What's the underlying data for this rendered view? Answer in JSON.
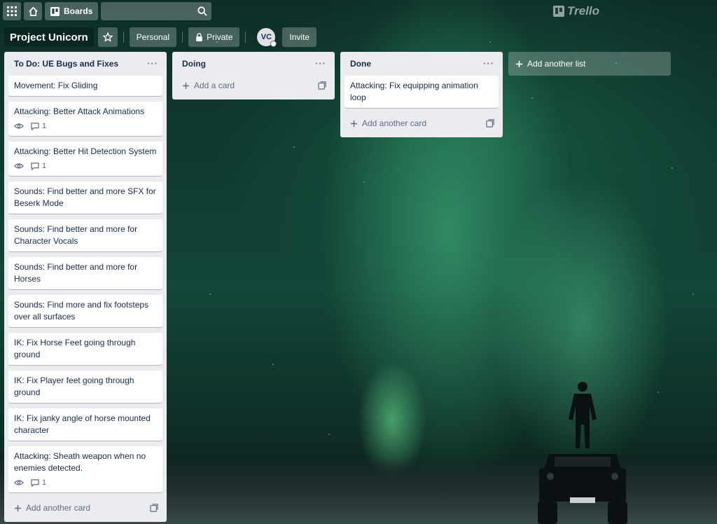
{
  "header": {
    "boards_label": "Boards",
    "search_placeholder": "",
    "logo_text": "Trello"
  },
  "board": {
    "title": "Project Unicorn",
    "personal_label": "Personal",
    "private_label": "Private",
    "avatar_initials": "VC",
    "invite_label": "Invite"
  },
  "lists": [
    {
      "title": "To Do: UE Bugs and Fixes",
      "cards": [
        {
          "title": "Movement: Fix Gliding"
        },
        {
          "title": "Attacking: Better Attack Animations",
          "comments": "1"
        },
        {
          "title": "Attacking: Better Hit Detection System",
          "comments": "1"
        },
        {
          "title": "Sounds: Find better and more SFX for Beserk Mode"
        },
        {
          "title": "Sounds: Find better and more for Character Vocals"
        },
        {
          "title": "Sounds: Find better and more for Horses"
        },
        {
          "title": "Sounds: Find more and fix footsteps over all surfaces"
        },
        {
          "title": "IK: Fix Horse Feet going through ground"
        },
        {
          "title": "IK: Fix Player feet going through ground"
        },
        {
          "title": "IK: Fix janky angle of horse mounted character"
        },
        {
          "title": "Attacking: Sheath weapon when no enemies detected.",
          "comments": "1"
        }
      ],
      "add_label": "Add another card"
    },
    {
      "title": "Doing",
      "cards": [],
      "add_label": "Add a card"
    },
    {
      "title": "Done",
      "cards": [
        {
          "title": "Attacking: Fix equipping animation loop"
        }
      ],
      "add_label": "Add another card"
    }
  ],
  "add_list_label": "Add another list",
  "icons": {
    "apps": "grid-icon",
    "home": "home-icon",
    "boards": "board-icon",
    "search": "search-icon",
    "star": "star-icon",
    "lock": "lock-icon",
    "watch": "eye-icon",
    "comment": "comment-icon",
    "template": "template-icon",
    "add": "plus-icon"
  }
}
